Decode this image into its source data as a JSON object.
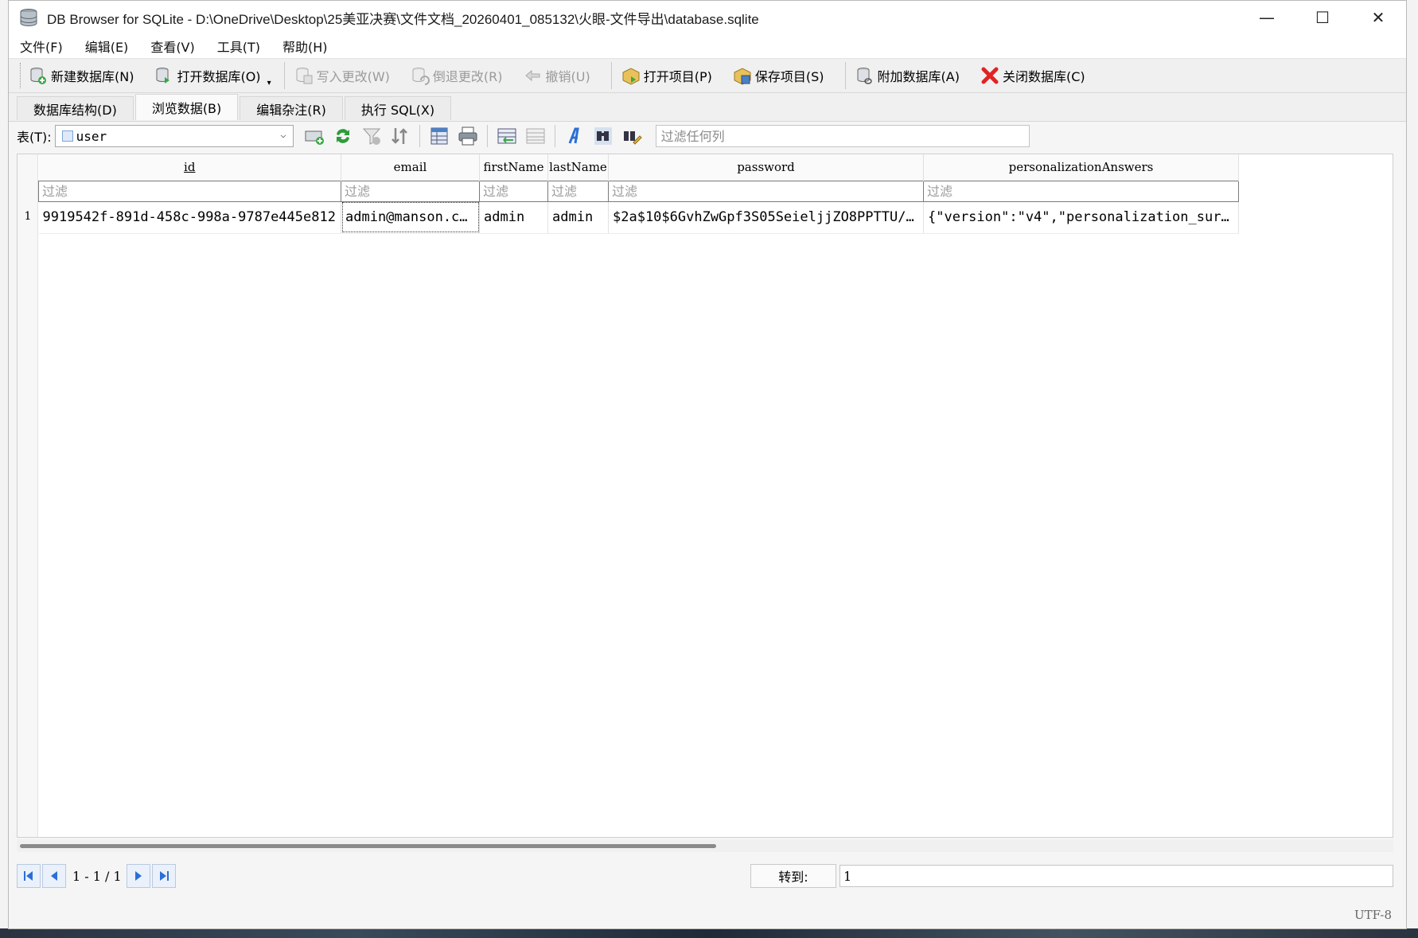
{
  "window": {
    "title": "DB Browser for SQLite - D:\\OneDrive\\Desktop\\25美亚决赛\\文件文档_20260401_085132\\火眼-文件导出\\database.sqlite",
    "minimize": "—",
    "maximize": "☐",
    "close": "✕"
  },
  "menu": [
    "文件(F)",
    "编辑(E)",
    "查看(V)",
    "工具(T)",
    "帮助(H)"
  ],
  "toolbar": {
    "new_db": "新建数据库(N)",
    "open_db": "打开数据库(O)",
    "write_changes": "写入更改(W)",
    "revert_changes": "倒退更改(R)",
    "undo": "撤销(U)",
    "open_project": "打开项目(P)",
    "save_project": "保存项目(S)",
    "attach_db": "附加数据库(A)",
    "close_db": "关闭数据库(C)"
  },
  "tabs": [
    "数据库结构(D)",
    "浏览数据(B)",
    "编辑杂注(R)",
    "执行 SQL(X)"
  ],
  "browse": {
    "table_label": "表(T):",
    "table_selected": "user",
    "filter_all_placeholder": "过滤任何列",
    "filter_placeholder": "过滤"
  },
  "grid": {
    "columns": [
      "id",
      "email",
      "firstName",
      "lastName",
      "password",
      "personalizationAnswers"
    ],
    "rows": [
      {
        "row_number": "1",
        "cells": [
          "9919542f-891d-458c-998a-9787e445e812",
          "admin@manson.com",
          "admin",
          "admin",
          "$2a$10$6GvhZwGpf3S05SeieljjZO8PPTTU/…",
          "{\"version\":\"v4\",\"personalization_sur…"
        ]
      }
    ]
  },
  "pager": {
    "range": "1 - 1 / 1",
    "goto_label": "转到:",
    "goto_value": "1"
  },
  "status": {
    "encoding": "UTF-8"
  }
}
